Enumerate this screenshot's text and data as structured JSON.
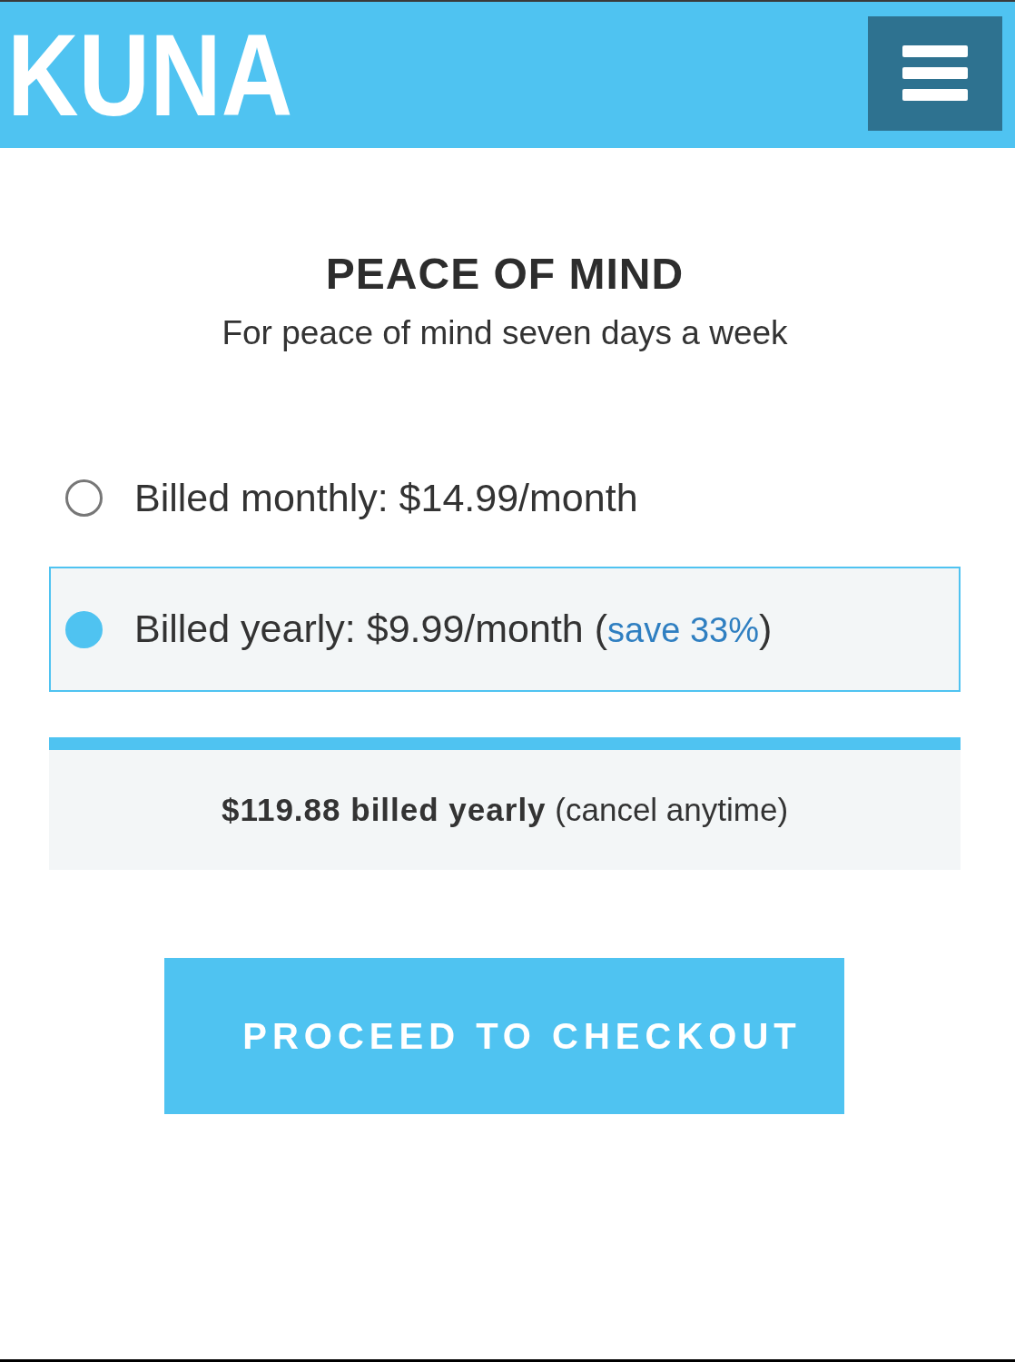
{
  "header": {
    "logo": "KUNA"
  },
  "plan": {
    "title": "PEACE OF MIND",
    "subtitle": "For peace of mind seven days a week"
  },
  "billing_options": [
    {
      "label": "Billed monthly: $14.99/month",
      "selected": false
    },
    {
      "label": "Billed yearly: $9.99/month",
      "note": {
        "open": "(",
        "text": "save 33%",
        "close": ")"
      },
      "selected": true
    }
  ],
  "summary": "**$119.88 billed yearly** (cancel anytime)",
  "checkout_button": "PROCEED TO CHECKOUT"
}
